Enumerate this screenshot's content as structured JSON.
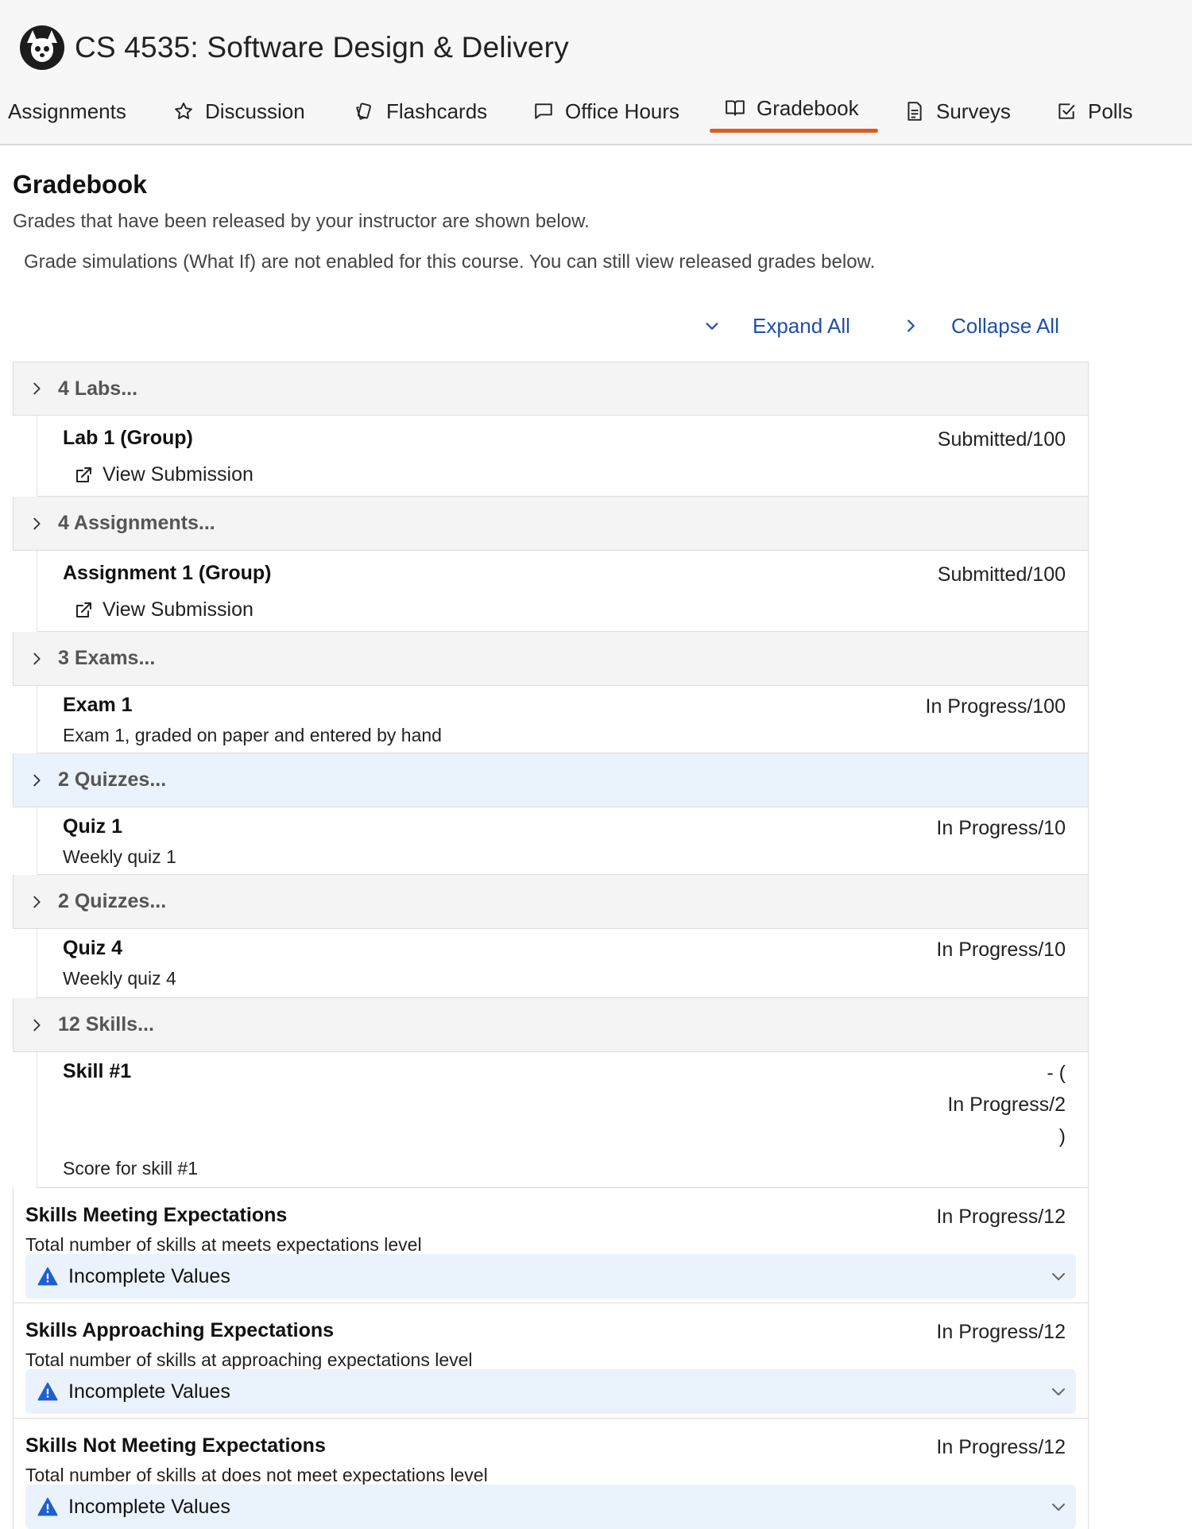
{
  "header": {
    "course_title": "CS 4535: Software Design & Delivery",
    "tabs": [
      {
        "label": "Assignments",
        "icon": "none"
      },
      {
        "label": "Discussion",
        "icon": "star-icon"
      },
      {
        "label": "Flashcards",
        "icon": "cards-icon"
      },
      {
        "label": "Office Hours",
        "icon": "chat-bubble-icon"
      },
      {
        "label": "Gradebook",
        "icon": "open-book-icon",
        "active": true
      },
      {
        "label": "Surveys",
        "icon": "document-icon"
      },
      {
        "label": "Polls",
        "icon": "checkbox-icon"
      }
    ],
    "active_tab_color": "#e05a1b"
  },
  "main": {
    "title": "Gradebook",
    "subtitle": "Grades that have been released by your instructor are shown below.",
    "simulation_note": "Grade simulations (What If) are not enabled for this course. You can still view released grades below.",
    "expand_all": "Expand All",
    "collapse_all": "Collapse All",
    "link_color": "#1f4fa8"
  },
  "groups": [
    {
      "name": "4 Labs...",
      "item": {
        "name": "Lab 1 (Group)",
        "score": "Submitted/100",
        "link": "View Submission"
      }
    },
    {
      "name": "4 Assignments...",
      "item": {
        "name": "Assignment 1 (Group)",
        "score": "Submitted/100",
        "link": "View Submission"
      }
    },
    {
      "name": "3 Exams...",
      "item": {
        "name": "Exam 1",
        "score": "In Progress/100",
        "description": "Exam 1, graded on paper and entered by hand"
      }
    },
    {
      "name": "2 Quizzes...",
      "highlighted": true,
      "item": {
        "name": "Quiz 1",
        "score": "In Progress/10",
        "description": "Weekly quiz 1"
      }
    },
    {
      "name": "2 Quizzes...",
      "item": {
        "name": "Quiz 4",
        "score": "In Progress/10",
        "description": "Weekly quiz 4"
      }
    },
    {
      "name": "12 Skills...",
      "item": {
        "name": "Skill #1",
        "score_line1": "- (",
        "score_line2": "In Progress/2",
        "score_line3": ")",
        "description": "Score for skill #1"
      }
    }
  ],
  "summaries": [
    {
      "name": "Skills Meeting Expectations",
      "score": "In Progress/12",
      "description": "Total number of skills at meets expectations level",
      "notice": "Incomplete Values"
    },
    {
      "name": "Skills Approaching Expectations",
      "score": "In Progress/12",
      "description": "Total number of skills at approaching expectations level",
      "notice": "Incomplete Values"
    },
    {
      "name": "Skills Not Meeting Expectations",
      "score": "In Progress/12",
      "description": "Total number of skills at does not meet expectations level",
      "notice": "Incomplete Values"
    }
  ]
}
